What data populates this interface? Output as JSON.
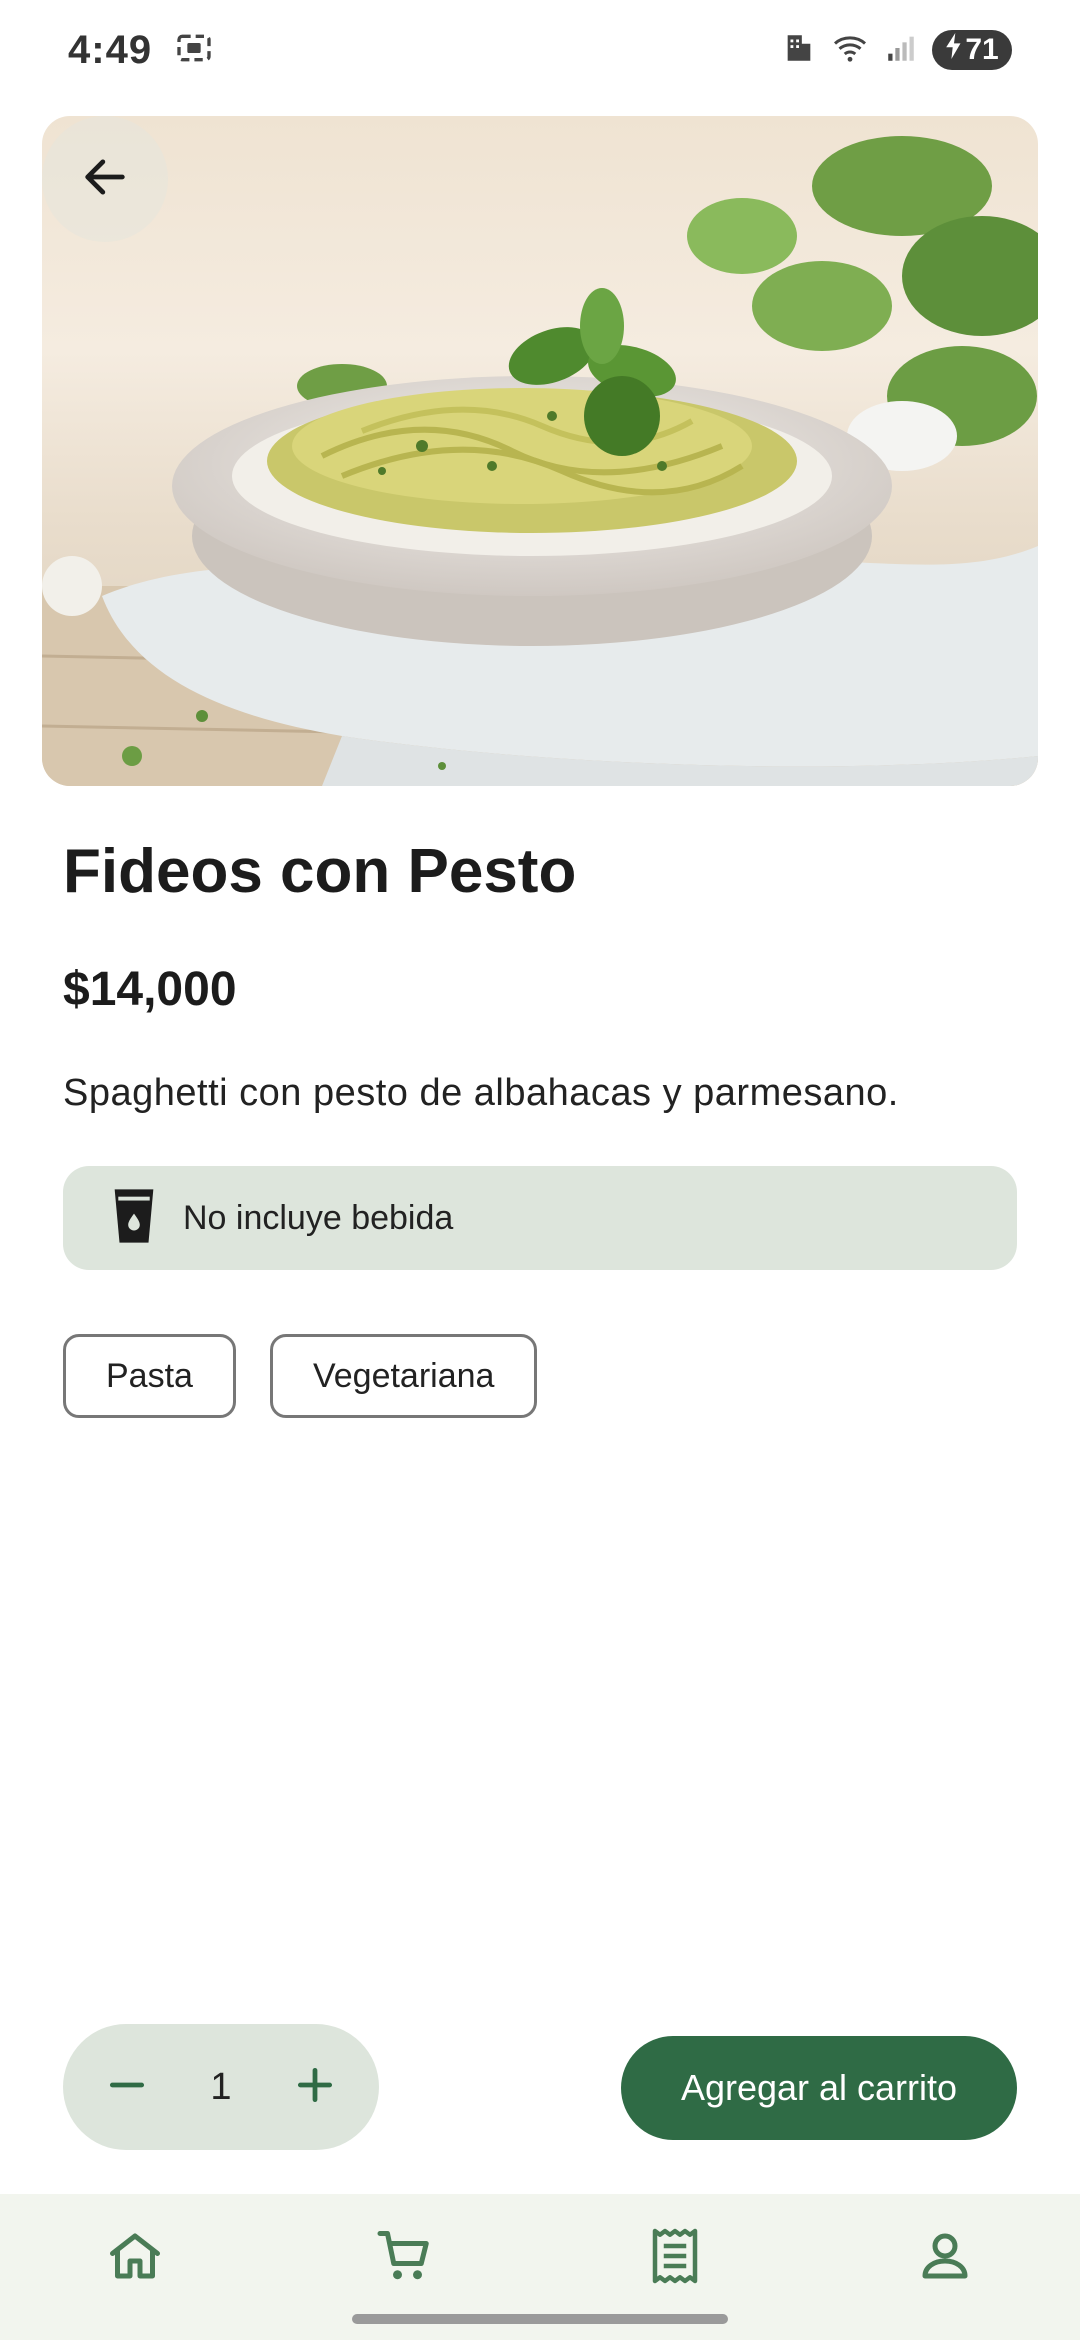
{
  "status_bar": {
    "time": "4:49",
    "battery": "71"
  },
  "product": {
    "name": "Fideos con Pesto",
    "price": "$14,000",
    "description": "Spaghetti con pesto de albahacas y parmesano.",
    "notice": "No incluye bebida",
    "notice_icon": "cup-icon",
    "tags": [
      "Pasta",
      "Vegetariana"
    ]
  },
  "cart_actions": {
    "quantity": "1",
    "add_label": "Agregar al carrito"
  },
  "bottom_nav": {
    "items": [
      {
        "icon": "home-icon"
      },
      {
        "icon": "cart-icon"
      },
      {
        "icon": "receipt-icon"
      },
      {
        "icon": "person-icon"
      }
    ]
  },
  "colors": {
    "accent": "#2f6b45",
    "chip_bg": "#dde5dc",
    "nav_bg": "#f2f5ee"
  }
}
